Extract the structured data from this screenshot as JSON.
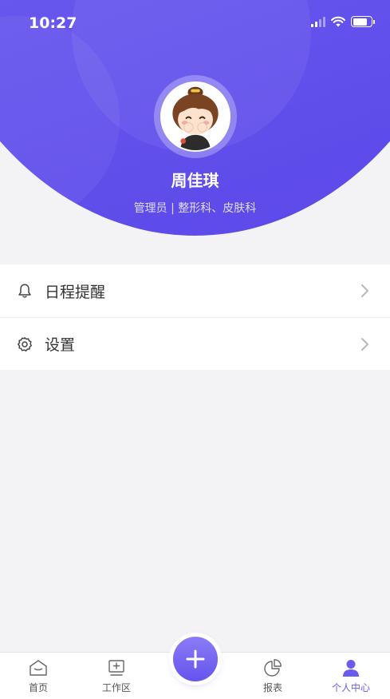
{
  "status_bar": {
    "time": "10:27"
  },
  "profile": {
    "name": "周佳琪",
    "role": "管理员 | 整形科、皮肤科"
  },
  "menu": {
    "items": [
      {
        "label": "日程提醒",
        "icon": "bell-icon"
      },
      {
        "label": "设置",
        "icon": "gear-icon"
      }
    ]
  },
  "tabbar": {
    "items": [
      {
        "label": "首页",
        "icon": "home-icon"
      },
      {
        "label": "工作区",
        "icon": "workspace-icon"
      },
      {
        "label": "报表",
        "icon": "pie-chart-icon"
      },
      {
        "label": "个人中心",
        "icon": "user-icon",
        "active": true
      }
    ],
    "fab_icon": "plus-icon"
  },
  "colors": {
    "accent": "#6b5cf0",
    "header_gradient_start": "#7c6cf3",
    "header_gradient_end": "#5a47e8",
    "page_background": "#f3f3f6"
  }
}
